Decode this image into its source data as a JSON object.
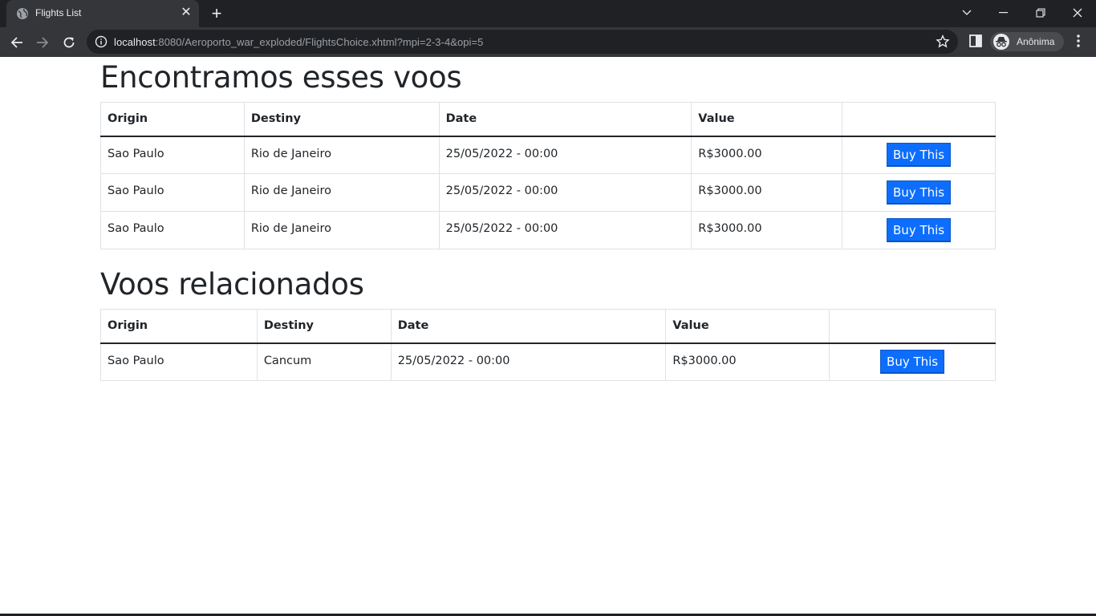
{
  "browser": {
    "tab_title": "Flights List",
    "url_host": "localhost",
    "url_rest": ":8080/Aeroporto_war_exploded/FlightsChoice.xhtml?mpi=2-3-4&opi=5",
    "profile_label": "Anônima"
  },
  "section1": {
    "title": "Encontramos esses voos",
    "headers": [
      "Origin",
      "Destiny",
      "Date",
      "Value",
      ""
    ],
    "rows": [
      {
        "origin": "Sao Paulo",
        "destiny": "Rio de Janeiro",
        "date": "25/05/2022 - 00:00",
        "value": "R$3000.00",
        "button": "Buy This"
      },
      {
        "origin": "Sao Paulo",
        "destiny": "Rio de Janeiro",
        "date": "25/05/2022 - 00:00",
        "value": "R$3000.00",
        "button": "Buy This"
      },
      {
        "origin": "Sao Paulo",
        "destiny": "Rio de Janeiro",
        "date": "25/05/2022 - 00:00",
        "value": "R$3000.00",
        "button": "Buy This"
      }
    ]
  },
  "section2": {
    "title": "Voos relacionados",
    "headers": [
      "Origin",
      "Destiny",
      "Date",
      "Value",
      ""
    ],
    "rows": [
      {
        "origin": "Sao Paulo",
        "destiny": "Cancum",
        "date": "25/05/2022 - 00:00",
        "value": "R$3000.00",
        "button": "Buy This"
      }
    ]
  },
  "colors": {
    "button_bg": "#0d6efd",
    "chrome_dark": "#202124",
    "chrome_toolbar": "#35363a"
  }
}
